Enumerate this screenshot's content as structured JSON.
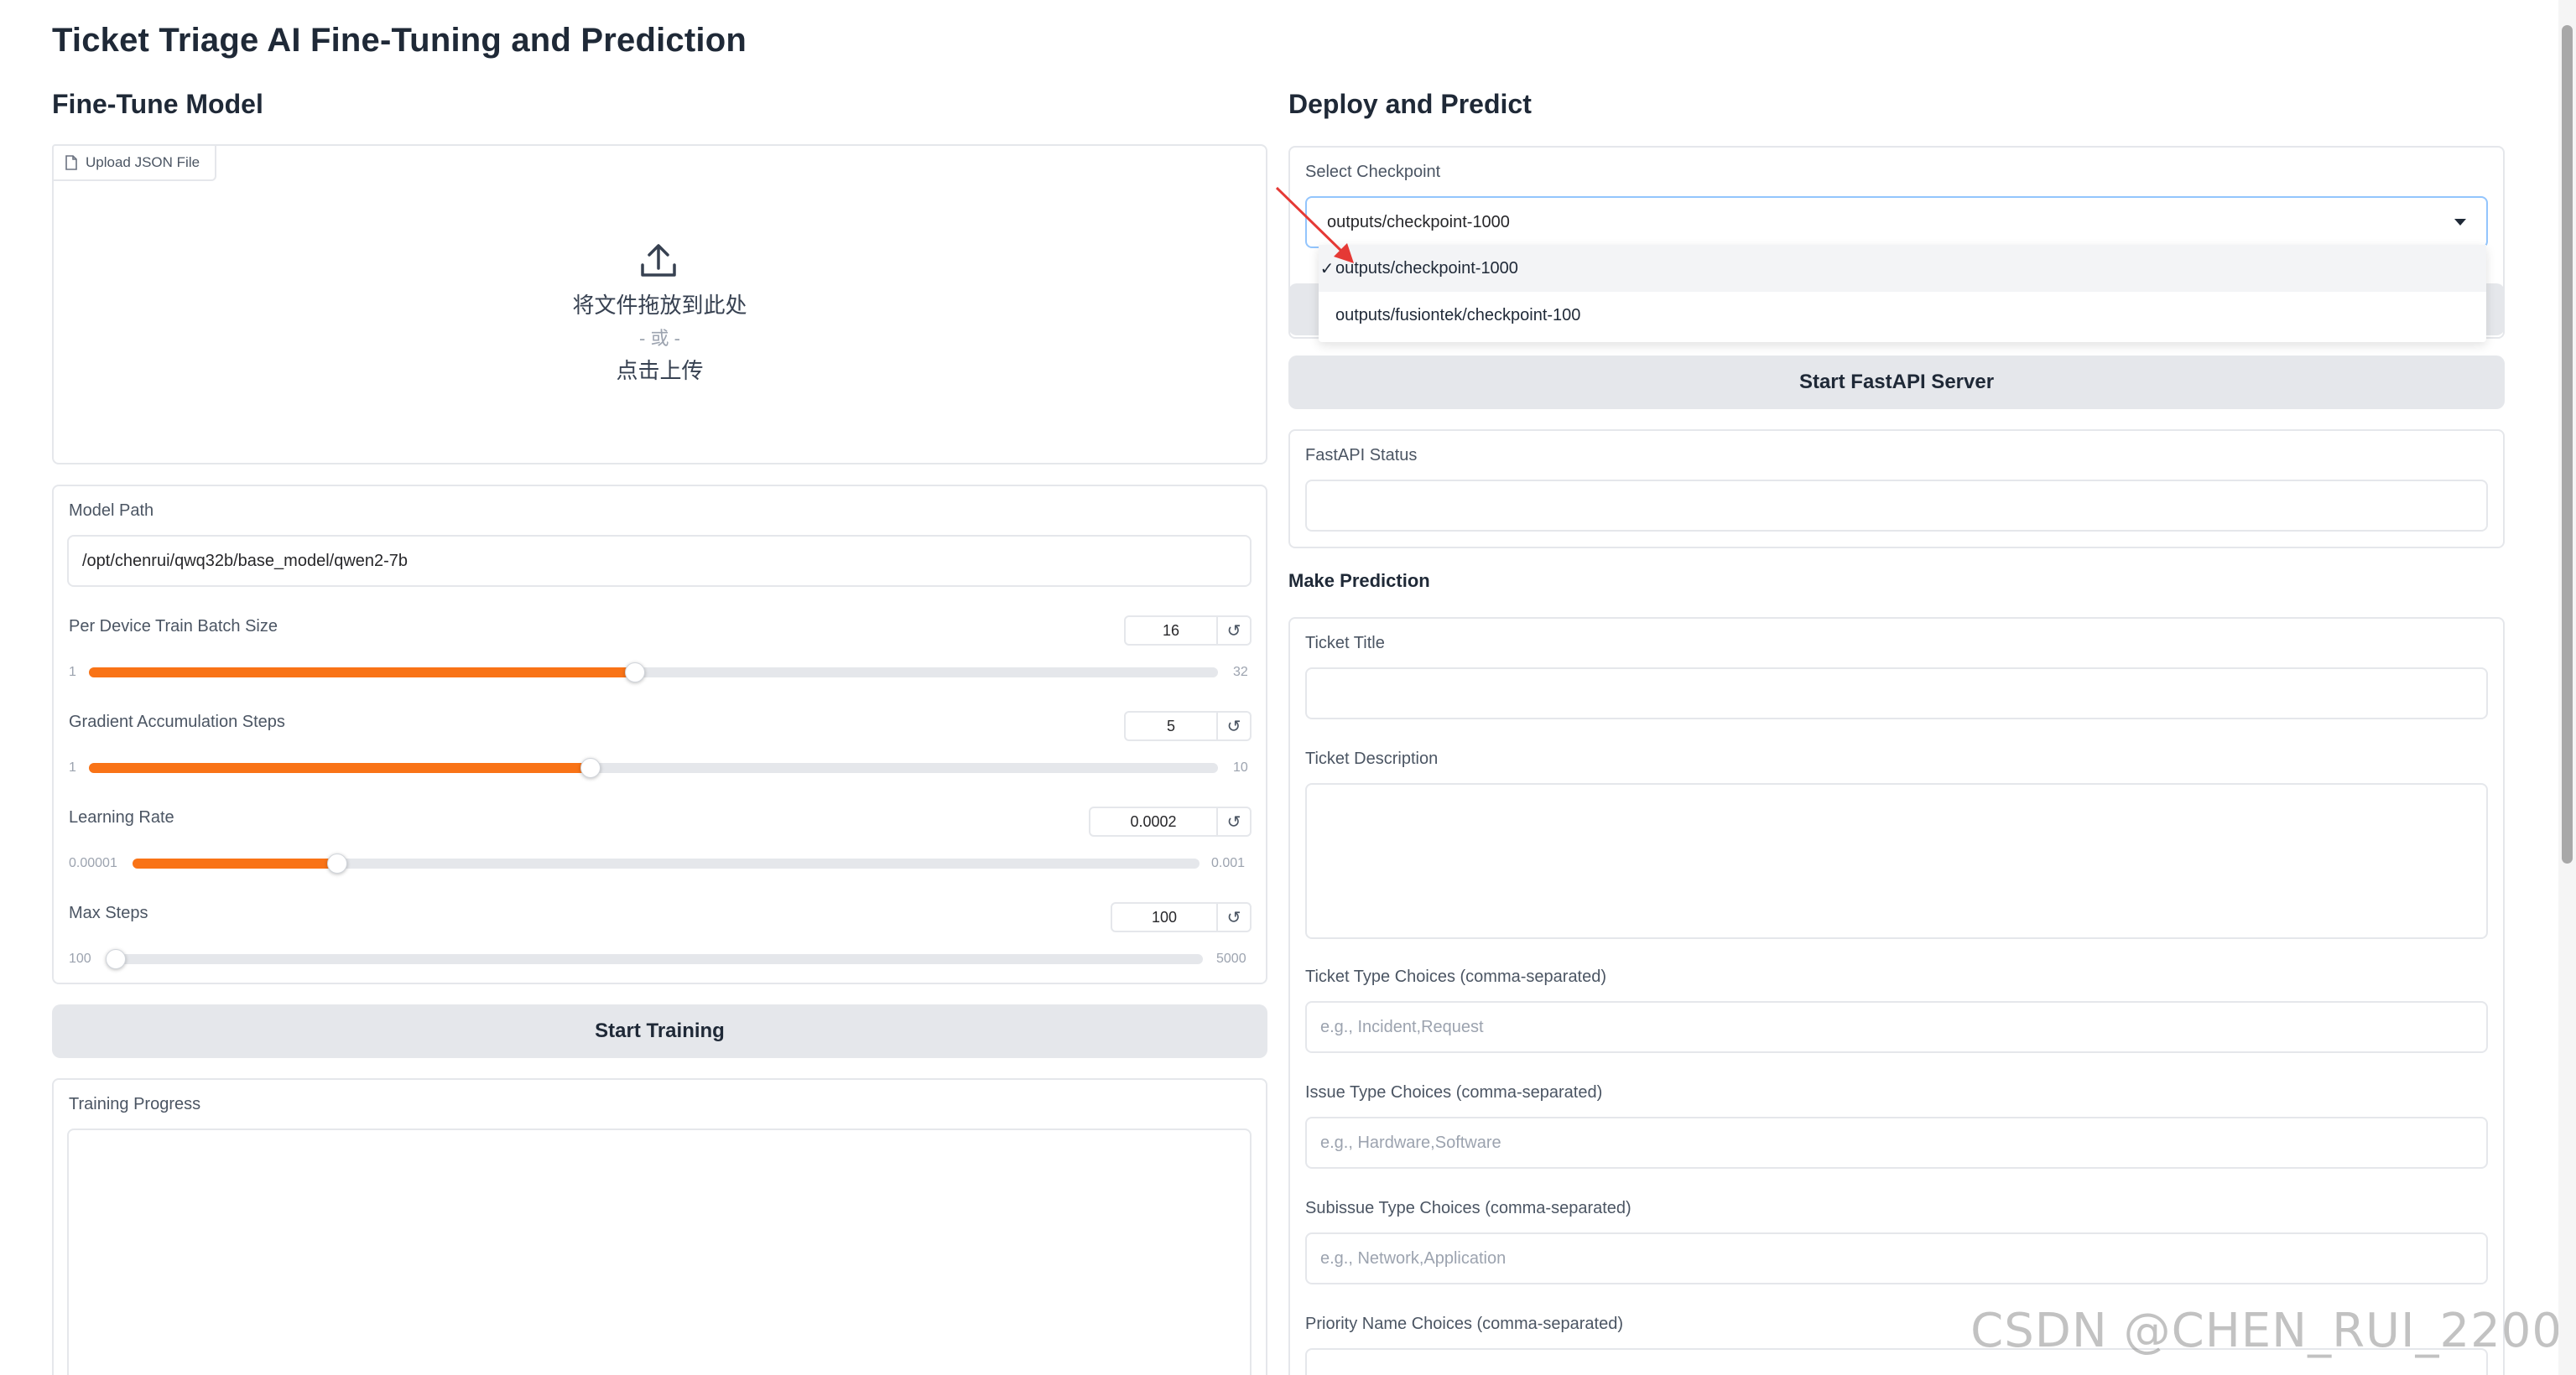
{
  "page": {
    "title": "Ticket Triage AI Fine-Tuning and Prediction"
  },
  "finetune": {
    "heading": "Fine-Tune Model",
    "upload": {
      "tab_label": "Upload JSON File",
      "drop_text": "将文件拖放到此处",
      "or_text": "- 或 -",
      "click_text": "点击上传"
    },
    "model_path": {
      "label": "Model Path",
      "value": "/opt/chenrui/qwq32b/base_model/qwen2-7b"
    },
    "sliders": [
      {
        "label": "Per Device Train Batch Size",
        "value": "16",
        "min": "1",
        "max": "32",
        "fraction": 0.484
      },
      {
        "label": "Gradient Accumulation Steps",
        "value": "5",
        "min": "1",
        "max": "10",
        "fraction": 0.444
      },
      {
        "label": "Learning Rate",
        "value": "0.0002",
        "min": "0.00001",
        "max": "0.001",
        "fraction": 0.192
      },
      {
        "label": "Max Steps",
        "value": "100",
        "min": "100",
        "max": "5000",
        "fraction": 0.0
      }
    ],
    "start_training_label": "Start Training",
    "training_progress_label": "Training Progress"
  },
  "deploy": {
    "heading": "Deploy and Predict",
    "checkpoint": {
      "label": "Select Checkpoint",
      "value": "outputs/checkpoint-1000",
      "options": [
        "outputs/checkpoint-1000",
        "outputs/fusiontek/checkpoint-100"
      ],
      "check_mark": "✓"
    },
    "start_fastapi_label": "Start FastAPI Server",
    "fastapi_status_label": "FastAPI Status"
  },
  "predict": {
    "heading": "Make Prediction",
    "ticket_title_label": "Ticket Title",
    "ticket_description_label": "Ticket Description",
    "ticket_type": {
      "label": "Ticket Type Choices (comma-separated)",
      "placeholder": "e.g., Incident,Request"
    },
    "issue_type": {
      "label": "Issue Type Choices (comma-separated)",
      "placeholder": "e.g., Hardware,Software"
    },
    "subissue_type": {
      "label": "Subissue Type Choices (comma-separated)",
      "placeholder": "e.g., Network,Application"
    },
    "priority": {
      "label": "Priority Name Choices (comma-separated)"
    }
  },
  "colors": {
    "accent": "#f97316",
    "annotation_arrow": "#e53935"
  },
  "watermark": "CSDN @CHEN_RUI_2200"
}
